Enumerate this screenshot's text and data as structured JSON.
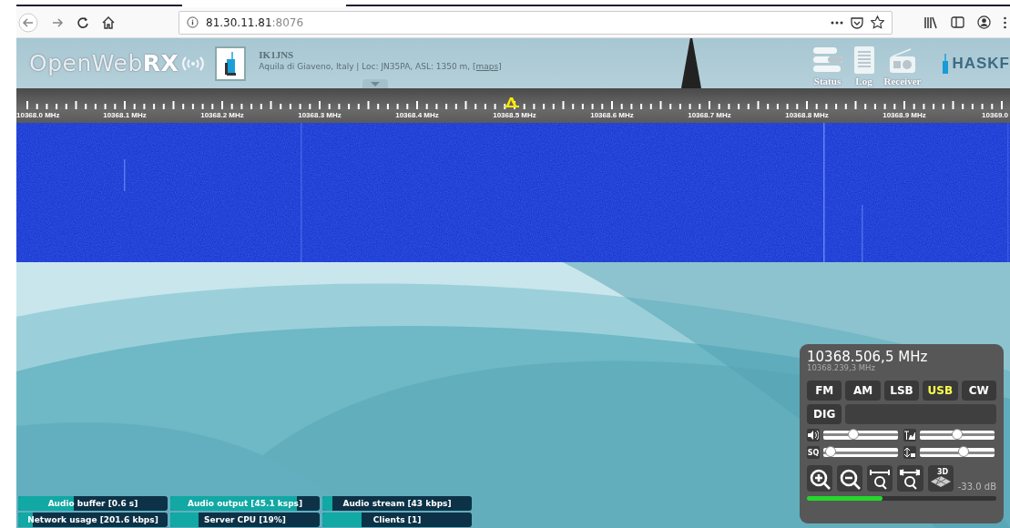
{
  "browser": {
    "url_host": "81.30.11.81",
    "url_port": ":8076"
  },
  "header": {
    "logo": "OpenWeb**RX**",
    "callsign": "IK1JNS",
    "location": "Aquila di Giaveno, Italy | Loc: JN35PA, ASL: 1350 m,",
    "maps_link": "[maps]",
    "sponsor": "HASKF",
    "buttons": [
      {
        "label": "Status",
        "kind": "status"
      },
      {
        "label": "Log",
        "kind": "log"
      },
      {
        "label": "Receiver",
        "kind": "receiver"
      }
    ]
  },
  "scale": {
    "labels": [
      "10368.0 MHz",
      "10368.1 MHz",
      "10368.2 MHz",
      "10368.3 MHz",
      "10368.4 MHz",
      "10368.5 MHz",
      "10368.6 MHz",
      "10368.7 MHz",
      "10368.8 MHz",
      "10368.9 MHz",
      "10369.0"
    ]
  },
  "receiver": {
    "frequency": "10368.506,5 MHz",
    "offset_frequency": "10368.239,3 MHz",
    "modes": [
      {
        "label": "FM",
        "selected": false
      },
      {
        "label": "AM",
        "selected": false
      },
      {
        "label": "LSB",
        "selected": false
      },
      {
        "label": "USB",
        "selected": true
      },
      {
        "label": "CW",
        "selected": false
      },
      {
        "label": "DIG",
        "selected": false
      }
    ],
    "sliders": [
      {
        "kind": "volume",
        "level": 0.38
      },
      {
        "kind": "waterfall",
        "level": 0.5
      },
      {
        "kind": "squelch",
        "label": "SQ",
        "level": 0.03
      },
      {
        "kind": "gain",
        "level": 0.6
      }
    ],
    "tools": [
      {
        "kind": "zoom-in"
      },
      {
        "kind": "zoom-out"
      },
      {
        "kind": "zoom-band"
      },
      {
        "kind": "zoom-full"
      },
      {
        "kind": "perspective",
        "label": "3D"
      }
    ],
    "smeter_reading": "-33.0 dB",
    "smeter": {
      "level": 0.4
    }
  },
  "status_bars": [
    {
      "label": "Audio buffer [0.6 s]",
      "level": 0.37
    },
    {
      "label": "Audio output [45.1 ksps]",
      "level": 0.85
    },
    {
      "label": "Audio stream [43 kbps]",
      "level": 0.07
    },
    {
      "label": "Network usage [201.6 kbps]",
      "level": 0.1
    },
    {
      "label": "Server CPU [19%]",
      "level": 0.19
    },
    {
      "label": "Clients [1]",
      "level": 0.26
    }
  ]
}
